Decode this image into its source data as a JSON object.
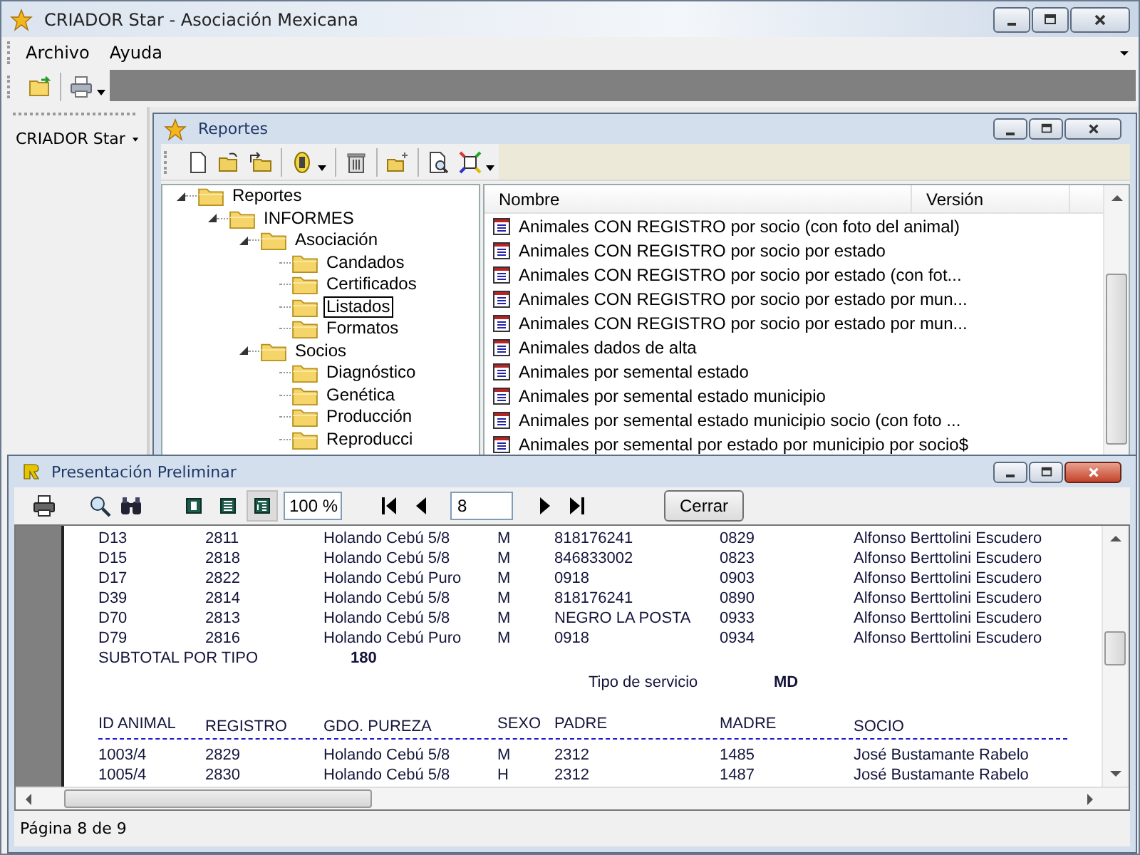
{
  "window": {
    "title": "CRIADOR Star - Asociación Mexicana"
  },
  "menu": [
    {
      "label": "Archivo"
    },
    {
      "label": "Ayuda"
    }
  ],
  "sidebar": {
    "title": "CRIADOR Star"
  },
  "reports_window": {
    "title": "Reportes",
    "tree": [
      {
        "label": "Reportes",
        "expanded": true,
        "selected": false,
        "children": [
          {
            "label": "INFORMES",
            "expanded": true,
            "selected": false,
            "children": [
              {
                "label": "Asociación",
                "expanded": true,
                "selected": false,
                "children": [
                  {
                    "label": "Candados",
                    "selected": false
                  },
                  {
                    "label": "Certificados",
                    "selected": false
                  },
                  {
                    "label": "Listados",
                    "selected": true
                  },
                  {
                    "label": "Formatos",
                    "selected": false
                  }
                ]
              },
              {
                "label": "Socios",
                "expanded": true,
                "selected": false,
                "children": [
                  {
                    "label": "Diagnóstico",
                    "selected": false
                  },
                  {
                    "label": "Genética",
                    "selected": false
                  },
                  {
                    "label": "Producción",
                    "selected": false
                  },
                  {
                    "label": "Reproducci",
                    "selected": false
                  }
                ]
              }
            ]
          }
        ]
      }
    ],
    "list": {
      "columns": [
        "Nombre",
        "Versión"
      ],
      "rows": [
        "Animales CON REGISTRO por socio (con foto del animal)",
        "Animales CON REGISTRO por socio por estado",
        "Animales CON REGISTRO por socio por estado (con fot...",
        "Animales CON REGISTRO por socio por estado por mun...",
        "Animales CON REGISTRO por socio por estado por mun...",
        "Animales dados de alta",
        "Animales por semental estado",
        "Animales por semental estado municipio",
        "Animales por semental estado municipio socio (con foto ...",
        "Animales por semental por estado por municipio por socio$"
      ]
    }
  },
  "preview_window": {
    "title": "Presentación Preliminar",
    "view_buttons": [
      {
        "selected": false
      },
      {
        "selected": false
      },
      {
        "selected": true
      }
    ],
    "zoom": "100 %",
    "page": "8",
    "close_button": "Cerrar",
    "report": [
      {
        "kind": "row",
        "cells": [
          "D13",
          "2811",
          "Holando Cebú 5/8",
          "M",
          "818176241",
          "0829",
          "Alfonso Berttolini Escudero"
        ]
      },
      {
        "kind": "row",
        "cells": [
          "D15",
          "2818",
          "Holando Cebú 5/8",
          "M",
          "846833002",
          "0823",
          "Alfonso Berttolini Escudero"
        ]
      },
      {
        "kind": "row",
        "cells": [
          "D17",
          "2822",
          "Holando Cebú Puro",
          "M",
          "0918",
          "0903",
          "Alfonso Berttolini Escudero"
        ]
      },
      {
        "kind": "row",
        "cells": [
          "D39",
          "2814",
          "Holando Cebú 5/8",
          "M",
          "818176241",
          "0890",
          "Alfonso Berttolini Escudero"
        ]
      },
      {
        "kind": "row",
        "cells": [
          "D70",
          "2813",
          "Holando Cebú 5/8",
          "M",
          "NEGRO LA POSTA",
          "0933",
          "Alfonso Berttolini Escudero"
        ]
      },
      {
        "kind": "row",
        "cells": [
          "D79",
          "2816",
          "Holando Cebú Puro",
          "M",
          "0918",
          "0934",
          "Alfonso Berttolini Escudero"
        ]
      },
      {
        "kind": "subtotal",
        "label": "SUBTOTAL POR TIPO",
        "value": "180"
      },
      {
        "kind": "service",
        "label": "Tipo de servicio",
        "value": "MD"
      },
      {
        "kind": "header",
        "cells": [
          "ID ANIMAL",
          "REGISTRO",
          "GDO. PUREZA",
          "SEXO",
          "PADRE",
          "MADRE",
          "SOCIO"
        ]
      },
      {
        "kind": "row",
        "cells": [
          "1003/4",
          "2829",
          "Holando Cebú 5/8",
          "M",
          "2312",
          "1485",
          "José Bustamante Rabelo"
        ]
      },
      {
        "kind": "row",
        "cells": [
          "1005/4",
          "2830",
          "Holando Cebú 5/8",
          "H",
          "2312",
          "1487",
          "José Bustamante Rabelo"
        ]
      }
    ],
    "status": "Página 8 de 9"
  }
}
